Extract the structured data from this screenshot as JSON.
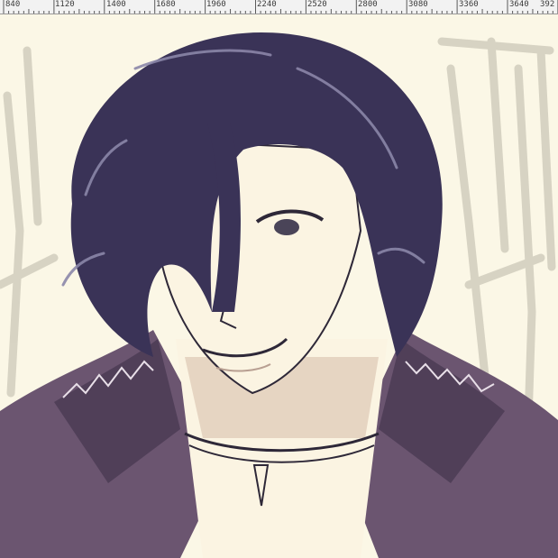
{
  "ruler": {
    "labels": [
      "840",
      "1120",
      "1400",
      "1680",
      "1960",
      "2240",
      "2520",
      "2800",
      "3080",
      "3360",
      "3640",
      "392"
    ]
  },
  "canvas": {
    "artwork": "anime-style-character-portrait",
    "colors": {
      "background": "#fbf7e6",
      "hair": "#3a3357",
      "hair_highlight": "#8b86a8",
      "skin": "#fbf4e2",
      "skin_shadow": "#d9bfae",
      "coat": "#6b5570",
      "coat_dark": "#4a3a52",
      "line": "#2e2838",
      "background_strokes": "#cfcbbb"
    }
  }
}
